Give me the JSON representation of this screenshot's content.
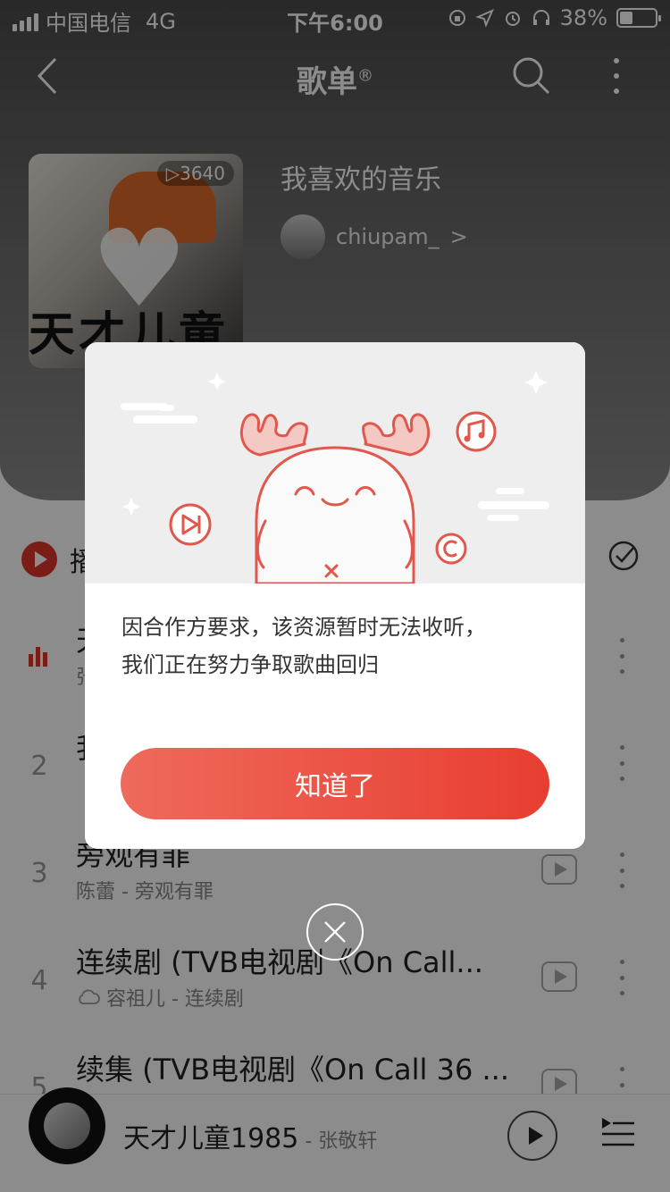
{
  "status_bar": {
    "carrier": "中国电信",
    "network": "4G",
    "time": "下午6:00",
    "battery": "38%",
    "battery_level": 0.38
  },
  "nav": {
    "title": "歌单",
    "title_mark": "®"
  },
  "playlist": {
    "play_count": "▷3640",
    "name": "我喜欢的音乐",
    "creator": "chiupam_",
    "cover_text": "天才儿童"
  },
  "list_header": {
    "play_all": "播"
  },
  "songs": [
    {
      "index": "",
      "title": "天",
      "subtitle": "张"
    },
    {
      "index": "2",
      "title": "我",
      "subtitle": ""
    },
    {
      "index": "3",
      "title": "旁观有罪",
      "subtitle": "陈蕾 - 旁观有罪"
    },
    {
      "index": "4",
      "title": "连续剧 (TVB电视剧《On Call...",
      "subtitle": "容祖儿 - 连续剧"
    },
    {
      "index": "5",
      "title": "续集 (TVB电视剧《On Call 36 ...",
      "subtitle": ""
    }
  ],
  "mini_player": {
    "title": "天才儿童1985",
    "separator": " - ",
    "artist": "张敬轩"
  },
  "dialog": {
    "message_line1": "因合作方要求，该资源暂时无法收听，",
    "message_line2": "我们正在努力争取歌曲回归",
    "confirm_label": "知道了"
  },
  "colors": {
    "accent": "#e83e31",
    "illustration_line": "#e2574c",
    "illustration_bg": "#eeeeee"
  },
  "icons": [
    "back-icon",
    "search-icon",
    "more-icon",
    "play-icon",
    "checklist-icon",
    "mv-icon",
    "cloud-icon",
    "close-icon",
    "queue-icon",
    "music-note-icon",
    "skip-icon",
    "copyright-icon"
  ]
}
